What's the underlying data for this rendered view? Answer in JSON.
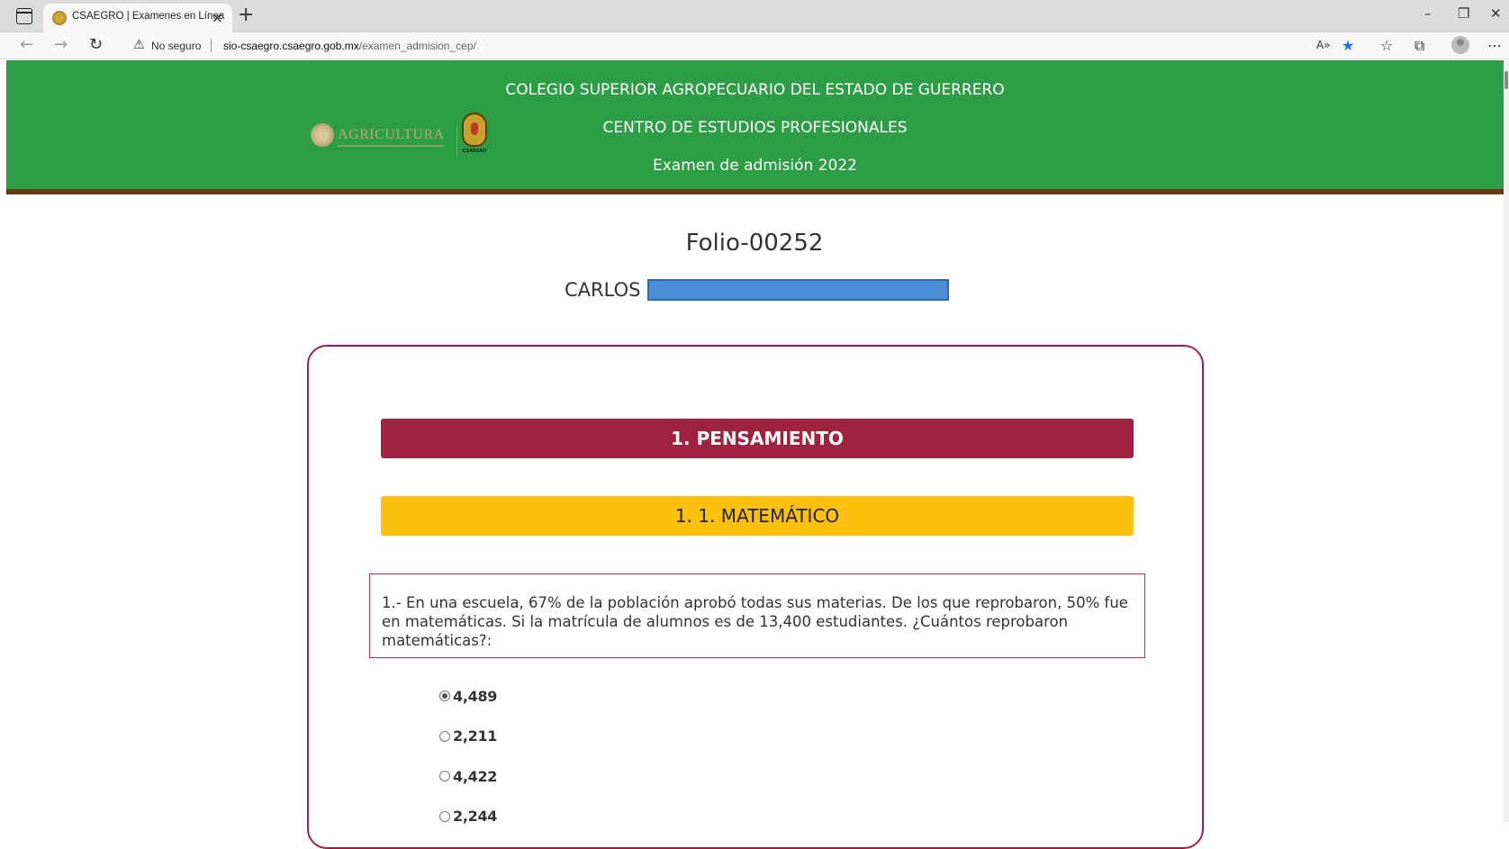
{
  "browser": {
    "tab_title": "CSAEGRO | Examenes en Línea",
    "tab_close": "×",
    "new_tab": "+",
    "security_label": "No seguro",
    "url_host": "sio-csaegro.csaegro.gob.mx",
    "url_path": "/examen_admision_cep/",
    "icons": [
      "sidebar-toggle-icon",
      "back-icon",
      "forward-icon",
      "reload-icon",
      "warning-icon",
      "read-aloud-icon",
      "favorite-star-icon",
      "favorites-icon",
      "collections-icon",
      "profile-icon",
      "more-icon",
      "minimize-icon",
      "restore-icon",
      "close-window-icon"
    ],
    "accent_color": "#1a73e8"
  },
  "header": {
    "line1": "COLEGIO SUPERIOR AGROPECUARIO DEL ESTADO DE GUERRERO",
    "line2": "CENTRO DE ESTUDIOS PROFESIONALES",
    "line3": "Examen de admisión 2022",
    "logo_agricultura": "AGRICULTURA",
    "logo_csaegro": "CSAEGRO",
    "bg_color": "#2e9e46",
    "stripe_color": "#6b3a14"
  },
  "student": {
    "folio": "Folio-00252",
    "first_name": "CARLOS"
  },
  "exam": {
    "section_title": "1. PENSAMIENTO",
    "section_color": "#9f2241",
    "subsection_title": "1. 1. MATEMÁTICO",
    "subsection_color": "#fbc10e",
    "question": "1.- En una escuela, 67% de la población aprobó todas sus materias. De los que reprobaron, 50% fue en matemáticas. Si la matrícula de alumnos es de 13,400 estudiantes. ¿Cuántos reprobaron matemáticas?:",
    "options": [
      {
        "label": "4,489",
        "selected": true
      },
      {
        "label": "2,211",
        "selected": false
      },
      {
        "label": "4,422",
        "selected": false
      },
      {
        "label": "2,244",
        "selected": false
      }
    ]
  }
}
